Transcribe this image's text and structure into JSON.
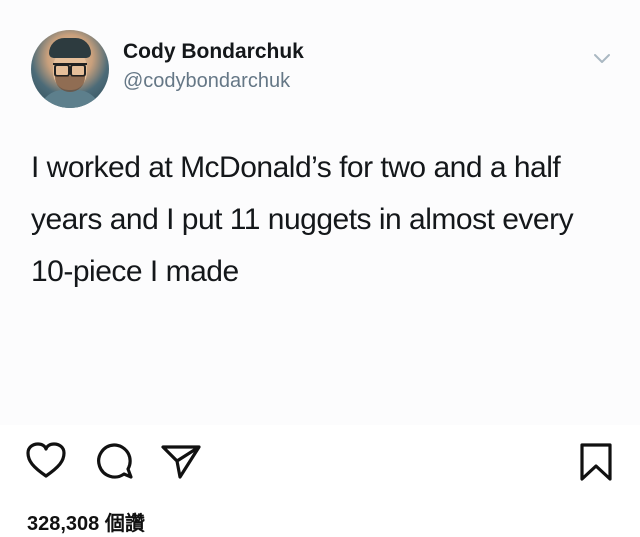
{
  "tweet": {
    "display_name": "Cody Bondarchuk",
    "handle": "@codybondarchuk",
    "text": "I worked at McDonald’s for two and a half years and I put 11 nuggets in almost every 10-piece I made",
    "menu_icon": "chevron-down-icon"
  },
  "post_actions": {
    "icons": [
      "heart-icon",
      "comment-icon",
      "share-icon",
      "bookmark-icon"
    ]
  },
  "likes": {
    "text": "328,308 個讚"
  },
  "colors": {
    "card_background": "#fcfcfd",
    "name_color": "#14171a",
    "handle_color": "#657786",
    "icon_color": "#111111"
  }
}
